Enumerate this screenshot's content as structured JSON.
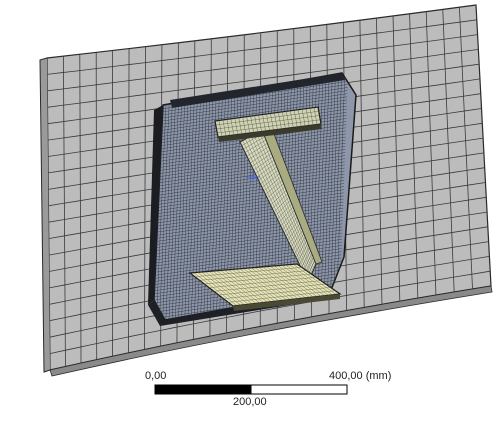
{
  "viewport": {
    "background": "#ffffff",
    "panel_color": "#bcbcbc",
    "panel_mesh_color": "#3a3a3a",
    "doubler_color": "#8d96a8",
    "bracket_color": "#e4e2b8",
    "cursor_icon": "crosshair-icon"
  },
  "scale_bar": {
    "label_start": "0,00",
    "label_end": "400,00 (mm)",
    "label_mid": "200,00"
  }
}
